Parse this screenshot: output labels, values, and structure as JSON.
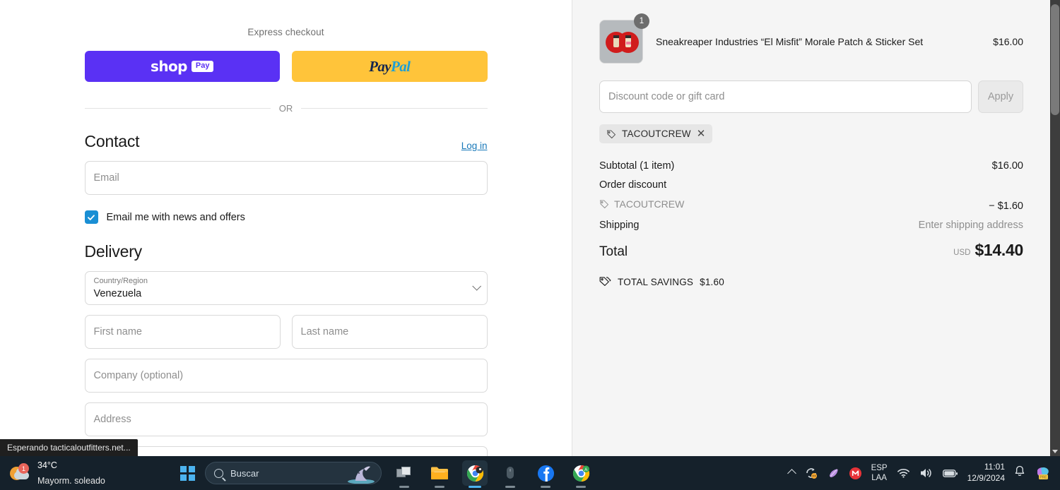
{
  "checkout": {
    "express_label": "Express checkout",
    "shop_pay": {
      "word": "shop",
      "chip": "Pay"
    },
    "paypal": {
      "part1": "Pay",
      "part2": "Pal"
    },
    "or": "OR",
    "contact_title": "Contact",
    "login_link": "Log in",
    "email_placeholder": "Email",
    "newsletter_label": "Email me with news and offers",
    "delivery_title": "Delivery",
    "country_label": "Country/Region",
    "country_value": "Venezuela",
    "first_name_placeholder": "First name",
    "last_name_placeholder": "Last name",
    "company_placeholder": "Company (optional)",
    "address_placeholder": "Address"
  },
  "summary": {
    "product_title": "Sneakreaper Industries “El Misfit” Morale Patch & Sticker Set",
    "product_price": "$16.00",
    "product_qty": "1",
    "discount_placeholder": "Discount code or gift card",
    "apply_label": "Apply",
    "chip_code": "TACOUTCREW",
    "chip_remove": "✕",
    "subtotal_label": "Subtotal (1 item)",
    "subtotal_value": "$16.00",
    "order_discount_label": "Order discount",
    "discount_code_label": "TACOUTCREW",
    "discount_code_value": "− $1.60",
    "shipping_label": "Shipping",
    "shipping_value": "Enter shipping address",
    "total_label": "Total",
    "total_currency": "USD",
    "total_value": "$14.40",
    "savings_label": "TOTAL SAVINGS",
    "savings_value": "$1.60"
  },
  "browser": {
    "status_text": "Esperando tacticaloutfitters.net..."
  },
  "taskbar": {
    "weather_temp": "34°C",
    "weather_desc": "Mayorm. soleado",
    "weather_badge": "1",
    "search_placeholder": "Buscar",
    "language_line1": "ESP",
    "language_line2": "LAA",
    "clock_time": "11:01",
    "clock_date": "12/9/2024"
  },
  "colors": {
    "shop_pay": "#5a31f4",
    "paypal": "#ffc43a",
    "checkbox": "#1a8fd4",
    "link": "#1878b9",
    "taskbar": "#15212b"
  }
}
